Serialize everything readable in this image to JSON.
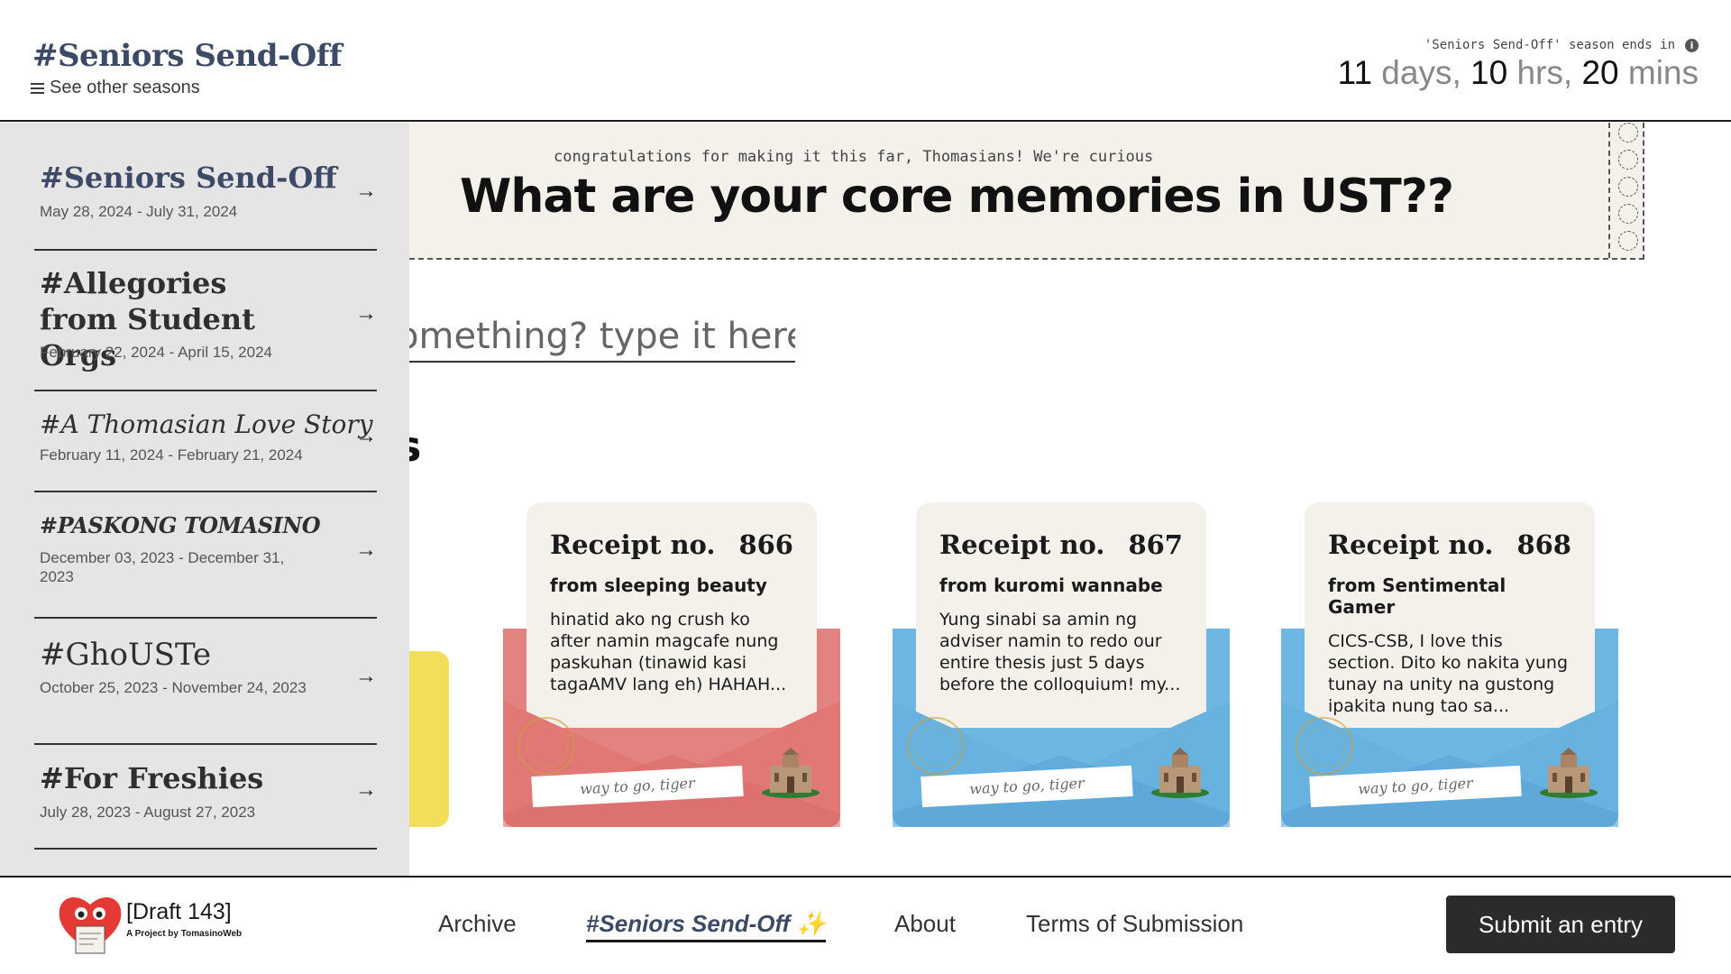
{
  "header": {
    "brand": "#Seniors Send-Off",
    "see_other_seasons": "See other seasons",
    "countdown_label": "'Seniors Send-Off' season ends in",
    "countdown": {
      "days": "11",
      "days_unit": " days, ",
      "hours": "10",
      "hours_unit": " hrs, ",
      "mins": "20",
      "mins_unit": " mins"
    }
  },
  "prompt": {
    "subtitle": "congratulations for making it this far, Thomasians! We're curious",
    "question": "What are your core memories in UST??"
  },
  "answer_input": {
    "placeholder_visible": "omething? type it here."
  },
  "section_heading_visible": "s",
  "seasons": [
    {
      "title": "#Seniors Send-Off",
      "dates": "May 28, 2024 - July 31, 2024"
    },
    {
      "title": "#Allegories from Student Orgs",
      "dates": "February 22, 2024 - April 15, 2024"
    },
    {
      "title": "#A Thomasian Love Story",
      "dates": "February 11, 2024 - February 21, 2024"
    },
    {
      "title": "#PASKONG TOMASINO",
      "dates": "December 03, 2023 - December 31, 2023"
    },
    {
      "title": "#GhoUSTe",
      "dates": "October 25, 2023 - November 24, 2023"
    },
    {
      "title": "#For Freshies",
      "dates": "July 28, 2023 - August 27, 2023"
    }
  ],
  "entries": [
    {
      "receipt_label": "Receipt no.",
      "number": "866",
      "from": "from sleeping beauty",
      "excerpt": "hinatid ako ng crush ko after namin magcafe nung paskuhan (tinawid kasi tagaAMV lang eh) HAHAH...",
      "strip": "way to go, tiger",
      "color": "#e38381"
    },
    {
      "receipt_label": "Receipt no.",
      "number": "867",
      "from": "from kuromi wannabe",
      "excerpt": "Yung sinabi sa amin ng adviser namin to redo our entire thesis just 5 days before the colloquium! my...",
      "strip": "way to go, tiger",
      "color": "#6fb7e3"
    },
    {
      "receipt_label": "Receipt no.",
      "number": "868",
      "from": "from Sentimental Gamer",
      "excerpt": "CICS-CSB, I love this section. Dito ko nakita yung tunay na unity na gustong ipakita nung tao sa...",
      "strip": "way to go, tiger",
      "color": "#6fb7e3"
    }
  ],
  "footer": {
    "logo_title": "[Draft 143]",
    "logo_sub": "A Project by TomasinoWeb",
    "nav": {
      "archive": "Archive",
      "current": "#Seniors Send-Off ✨",
      "about": "About",
      "terms": "Terms of Submission"
    },
    "submit": "Submit an entry"
  }
}
